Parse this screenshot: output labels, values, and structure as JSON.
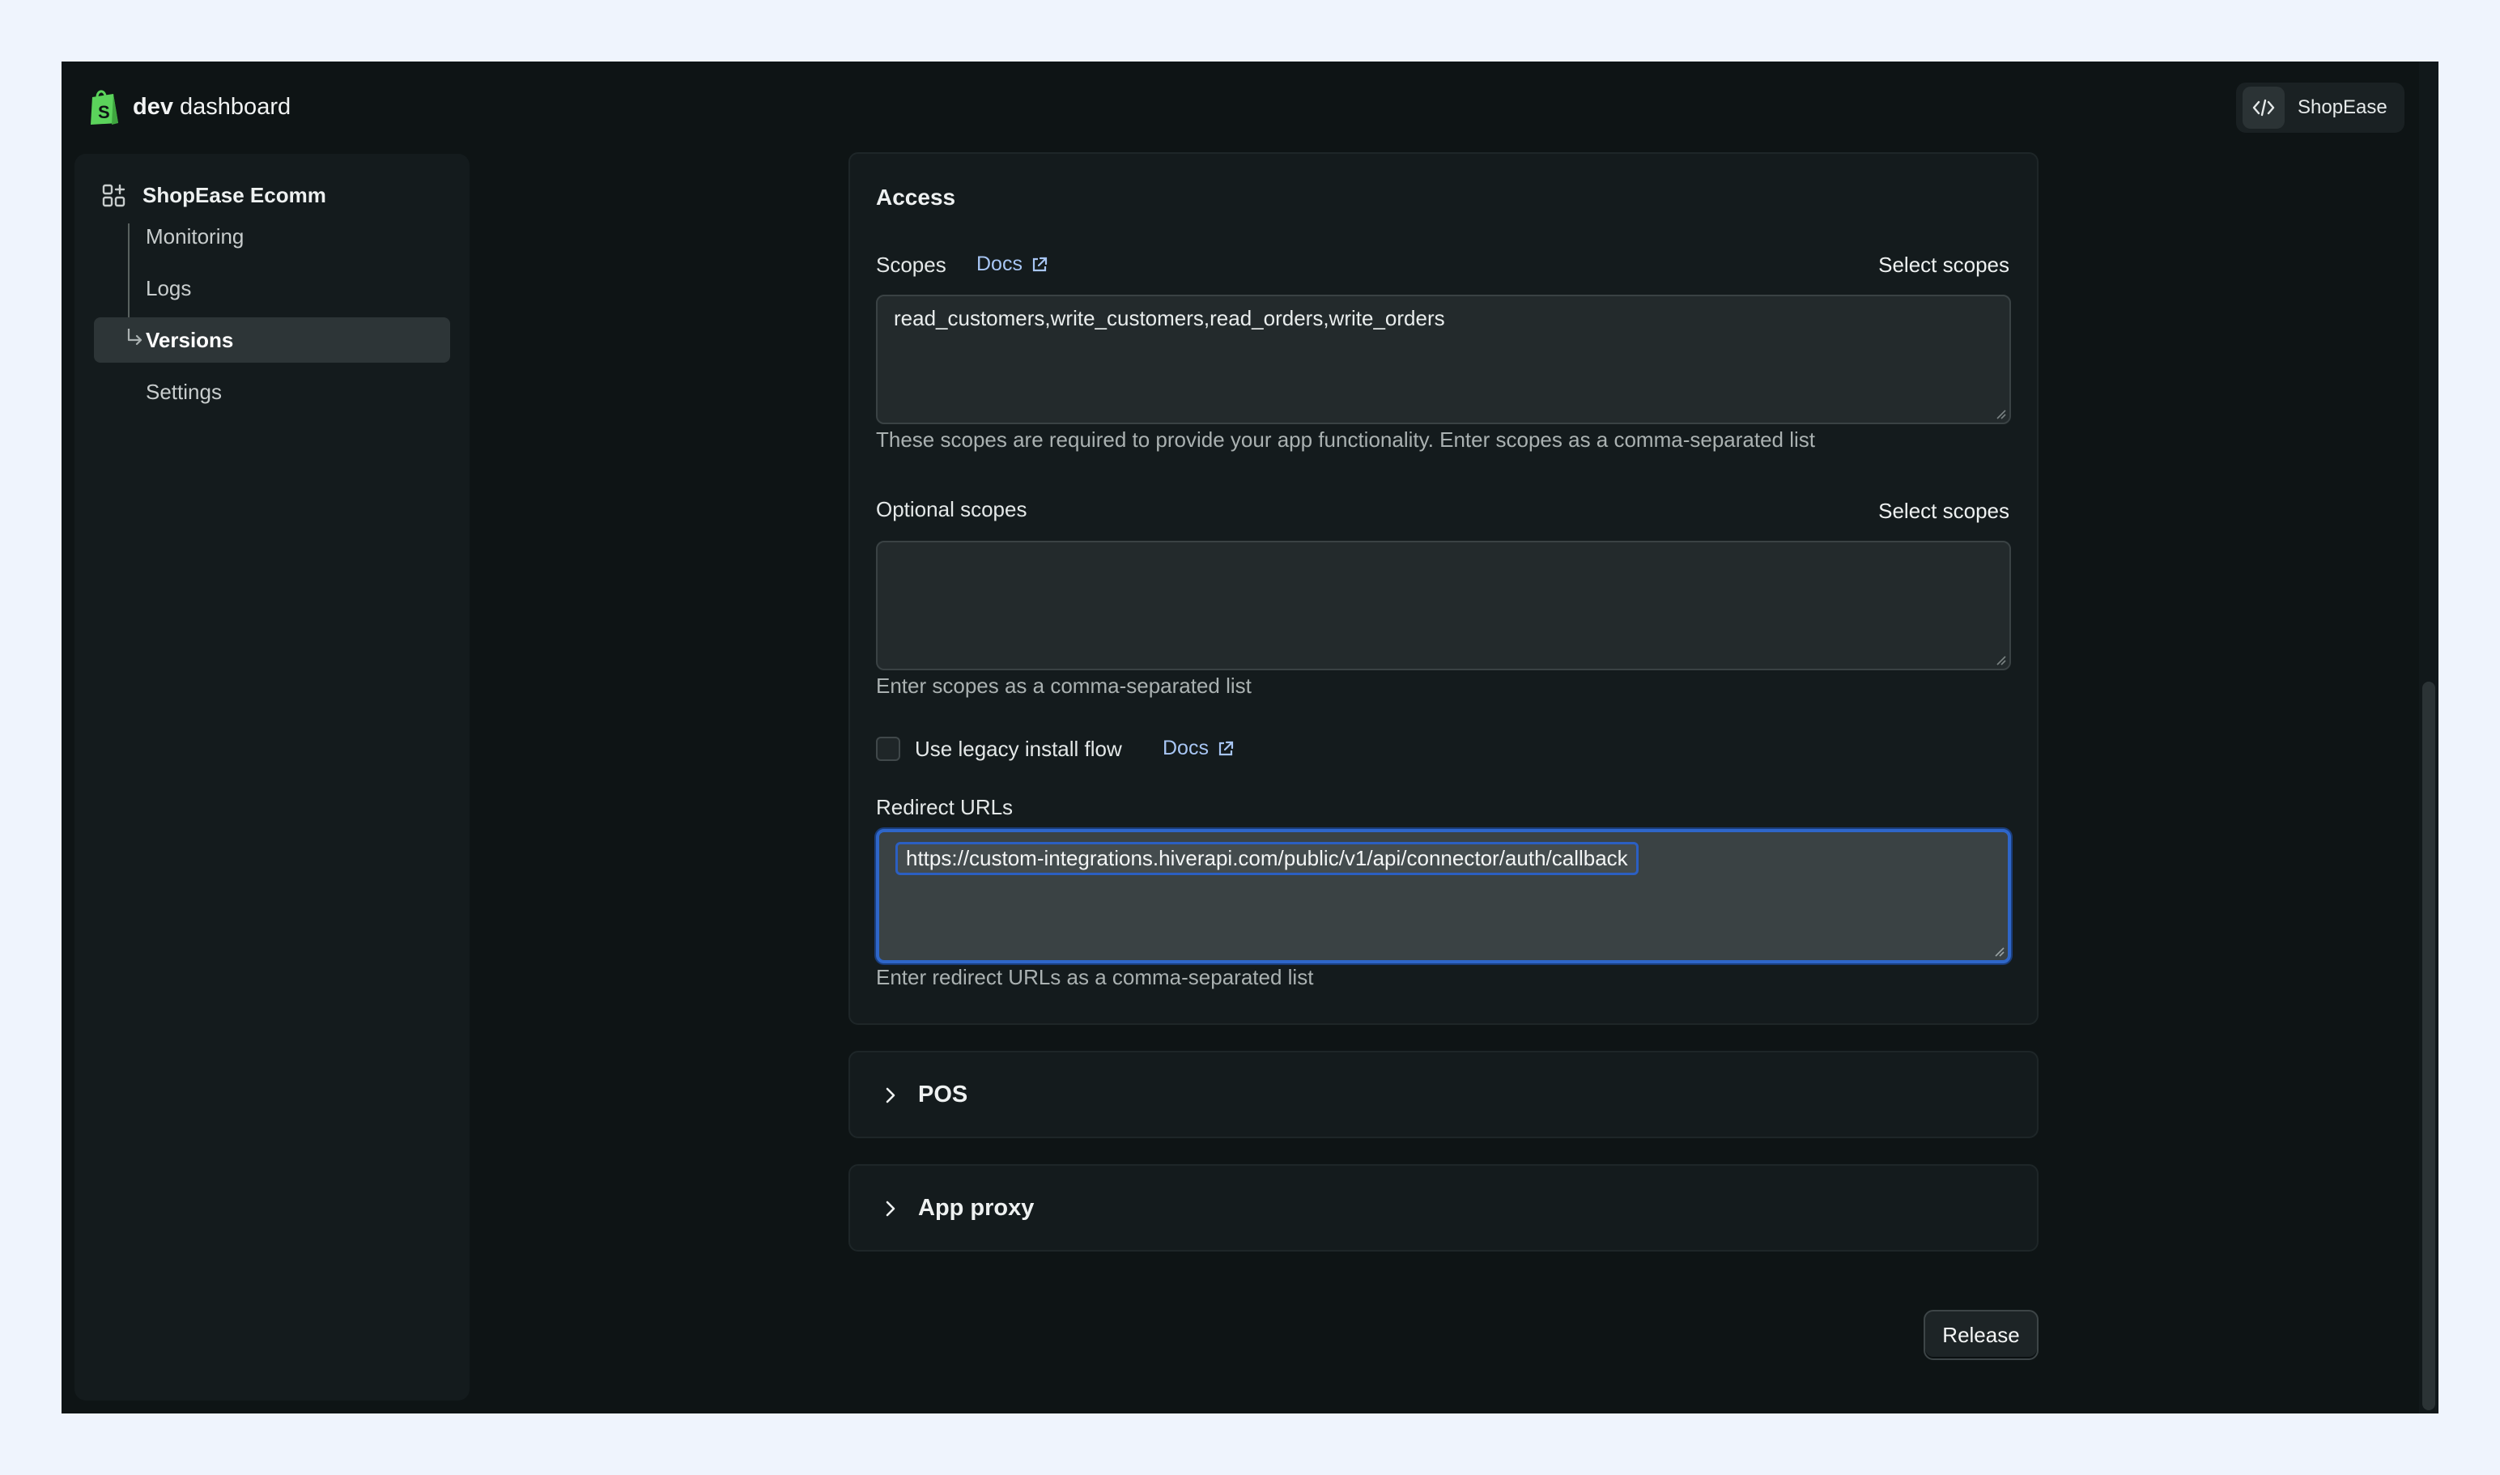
{
  "header": {
    "brand_bold": "dev",
    "brand_rest": "dashboard",
    "store_button_label": "ShopEase",
    "brand_color": "#5bd35b"
  },
  "sidebar": {
    "app_name": "ShopEase Ecomm",
    "items": [
      {
        "label": "Monitoring",
        "active": false
      },
      {
        "label": "Logs",
        "active": false
      },
      {
        "label": "Versions",
        "active": true
      },
      {
        "label": "Settings",
        "active": false
      }
    ]
  },
  "access": {
    "title": "Access",
    "scopes_label": "Scopes",
    "scopes_docs": "Docs",
    "scopes_select": "Select scopes",
    "scopes_value": "read_customers,write_customers,read_orders,write_orders",
    "scopes_help": "These scopes are required to provide your app functionality. Enter scopes as a comma-separated list",
    "optional_label": "Optional scopes",
    "optional_select": "Select scopes",
    "optional_value": "",
    "optional_help": "Enter scopes as a comma-separated list",
    "legacy_label": "Use legacy install flow",
    "legacy_docs": "Docs",
    "legacy_checked": false,
    "redirect_label": "Redirect URLs",
    "redirect_value": "https://custom-integrations.hiverapi.com/public/v1/api/connector/auth/callback",
    "redirect_help": "Enter redirect URLs as a comma-separated list"
  },
  "sections": {
    "pos": "POS",
    "app_proxy": "App proxy"
  },
  "footer": {
    "release_label": "Release"
  },
  "icons": {
    "brand": "shopify-bag-icon",
    "store": "code-icon",
    "app": "apps-icon",
    "external": "external-link-icon",
    "chevron": "chevron-right-icon"
  }
}
